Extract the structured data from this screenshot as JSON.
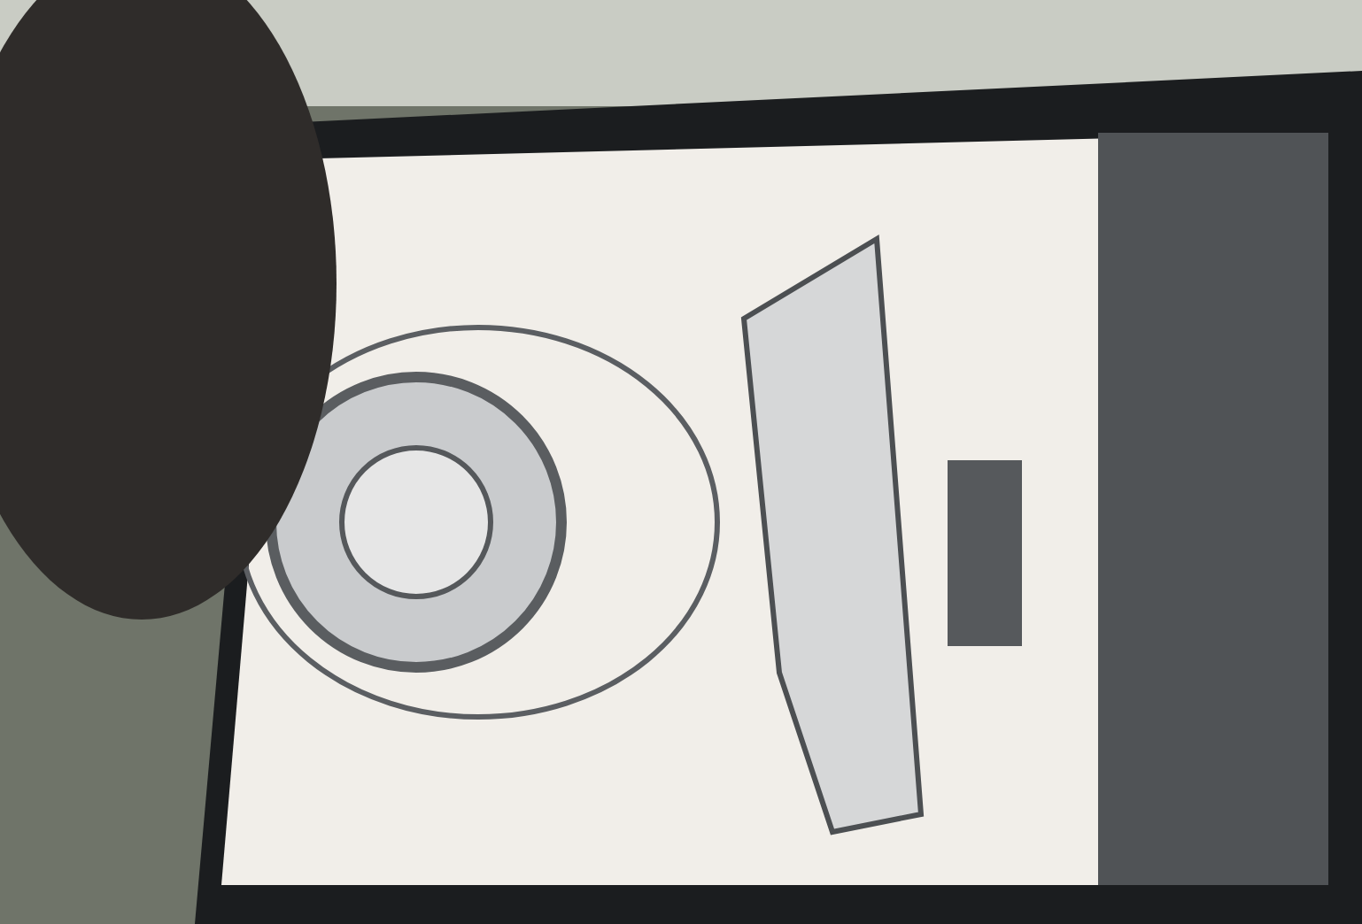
{
  "scene": {
    "kind": "photo"
  }
}
